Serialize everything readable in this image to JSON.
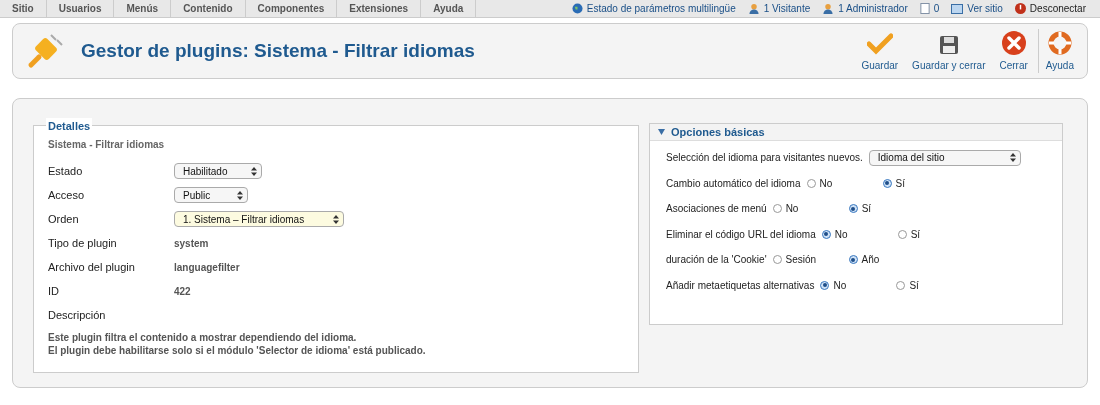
{
  "menu": [
    {
      "label": "Sitio"
    },
    {
      "label": "Usuarios"
    },
    {
      "label": "Menús"
    },
    {
      "label": "Contenido"
    },
    {
      "label": "Componentes"
    },
    {
      "label": "Extensiones"
    },
    {
      "label": "Ayuda"
    }
  ],
  "status": [
    {
      "kind": "globe",
      "label": "Estado de parámetros multilingüe"
    },
    {
      "kind": "user",
      "label": "1 Visitante"
    },
    {
      "kind": "user",
      "label": "1 Administrador"
    },
    {
      "kind": "message",
      "label": "0"
    },
    {
      "kind": "screen",
      "label": "Ver sitio"
    },
    {
      "kind": "logout",
      "label": "Desconectar"
    }
  ],
  "header": {
    "title": "Gestor de plugins: Sistema - Filtrar idiomas"
  },
  "toolbar": [
    {
      "kind": "check",
      "label": "Guardar"
    },
    {
      "kind": "disk",
      "label": "Guardar y cerrar"
    },
    {
      "kind": "close",
      "label": "Cerrar"
    },
    {
      "kind": "help",
      "label": "Ayuda"
    }
  ],
  "details": {
    "legend": "Detalles",
    "subtitle": "Sistema - Filtrar idiomas",
    "fields": [
      {
        "kind": "select",
        "label": "Estado",
        "value": "Habilitado"
      },
      {
        "kind": "select",
        "label": "Acceso",
        "value": "Public"
      },
      {
        "kind": "select",
        "label": "Orden",
        "value": "1. Sistema – Filtrar idiomas"
      },
      {
        "kind": "text",
        "label": "Tipo de plugin",
        "value": "system"
      },
      {
        "kind": "text",
        "label": "Archivo del plugin",
        "value": "languagefilter"
      },
      {
        "kind": "text",
        "label": "ID",
        "value": "422"
      },
      {
        "kind": "label",
        "label": "Descripción"
      }
    ],
    "description": [
      "Este plugin filtra el contenido a mostrar dependiendo del idioma.",
      "El plugin debe habilitarse solo si el módulo 'Selector de idioma' está publicado."
    ]
  },
  "options": {
    "title": "Opciones básicas",
    "expanded": true,
    "rows": [
      {
        "kind": "select",
        "label": "Selección del idioma para visitantes nuevos.",
        "value": "Idioma del sitio"
      },
      {
        "kind": "radio",
        "label": "Cambio automático del idioma",
        "choices": [
          {
            "label": "No",
            "selected": false
          },
          {
            "label": "Sí",
            "selected": true
          }
        ]
      },
      {
        "kind": "radio",
        "label": "Asociaciones de menú",
        "choices": [
          {
            "label": "No",
            "selected": false
          },
          {
            "label": "Sí",
            "selected": true
          }
        ]
      },
      {
        "kind": "radio",
        "label": "Eliminar el código URL del idioma",
        "choices": [
          {
            "label": "No",
            "selected": true
          },
          {
            "label": "Sí",
            "selected": false
          }
        ]
      },
      {
        "kind": "radio",
        "label": "duración de la 'Cookie'",
        "choices": [
          {
            "label": "Sesión",
            "selected": false
          },
          {
            "label": "Año",
            "selected": true
          }
        ]
      },
      {
        "kind": "radio",
        "label": "Añadir metaetiquetas alternativas",
        "choices": [
          {
            "label": "No",
            "selected": true
          },
          {
            "label": "Sí",
            "selected": false
          }
        ]
      }
    ]
  }
}
